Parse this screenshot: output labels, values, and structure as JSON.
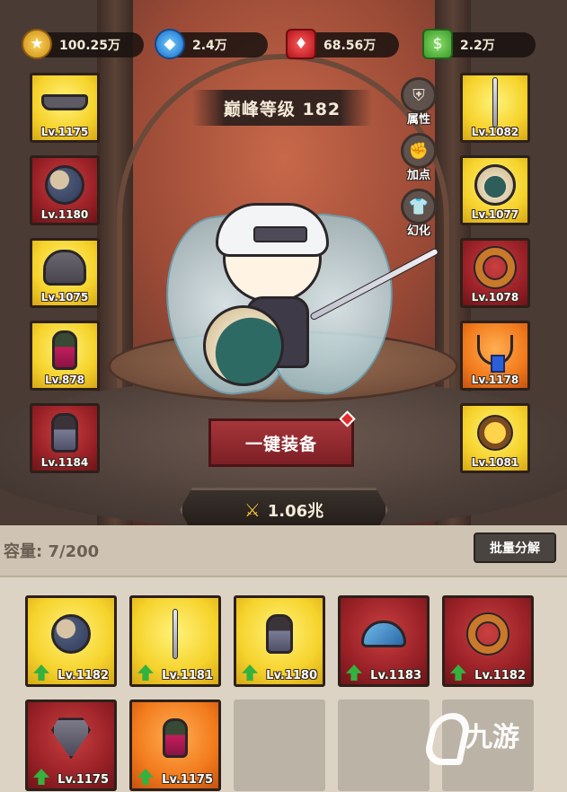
{
  "currency": {
    "gold": "100.25万",
    "diamond": "2.4万",
    "ruby": "68.56万",
    "cash": "2.2万"
  },
  "level_banner": "巅峰等级 182",
  "side_menu": [
    {
      "label": "属性",
      "icon": "armor-icon"
    },
    {
      "label": "加点",
      "icon": "fist-icon"
    },
    {
      "label": "幻化",
      "icon": "outfit-icon"
    }
  ],
  "equipment_left": [
    {
      "level": "Lv.1175",
      "rarity": "yellow",
      "item": "headband"
    },
    {
      "level": "Lv.1180",
      "rarity": "red",
      "item": "shoulder-armor"
    },
    {
      "level": "Lv.1075",
      "rarity": "yellow",
      "item": "helmet"
    },
    {
      "level": "Lv.878",
      "rarity": "yellow",
      "item": "glove"
    },
    {
      "level": "Lv.1184",
      "rarity": "red",
      "item": "boot"
    }
  ],
  "equipment_right": [
    {
      "level": "Lv.1082",
      "rarity": "yellow",
      "item": "sword"
    },
    {
      "level": "Lv.1077",
      "rarity": "yellow",
      "item": "chest-armor"
    },
    {
      "level": "Lv.1078",
      "rarity": "red",
      "item": "ring"
    },
    {
      "level": "Lv.1178",
      "rarity": "orange",
      "item": "necklace"
    },
    {
      "level": "Lv.1081",
      "rarity": "yellow",
      "item": "amulet"
    }
  ],
  "equip_button": "一键装备",
  "power": "1.06兆",
  "inventory": {
    "capacity": "容量: 7/200",
    "bulk_button": "批量分解",
    "items": [
      {
        "level": "Lv.1182",
        "rarity": "yellow",
        "item": "shoulder-armor",
        "upgrade": true
      },
      {
        "level": "Lv.1181",
        "rarity": "yellow",
        "item": "sword",
        "upgrade": true
      },
      {
        "level": "Lv.1180",
        "rarity": "yellow",
        "item": "boot",
        "upgrade": true
      },
      {
        "level": "Lv.1183",
        "rarity": "red",
        "item": "wave-necklace",
        "upgrade": true
      },
      {
        "level": "Lv.1182",
        "rarity": "red",
        "item": "ring",
        "upgrade": true
      },
      {
        "level": "Lv.1175",
        "rarity": "red",
        "item": "shield",
        "upgrade": true
      },
      {
        "level": "Lv.1175",
        "rarity": "orange",
        "item": "glove",
        "upgrade": true
      }
    ]
  },
  "watermark": "九游",
  "colors": {
    "rarity_yellow": "#f6d32c",
    "rarity_red": "#9a2127",
    "rarity_orange": "#f27b1d",
    "upgrade_arrow": "#33b23f"
  }
}
